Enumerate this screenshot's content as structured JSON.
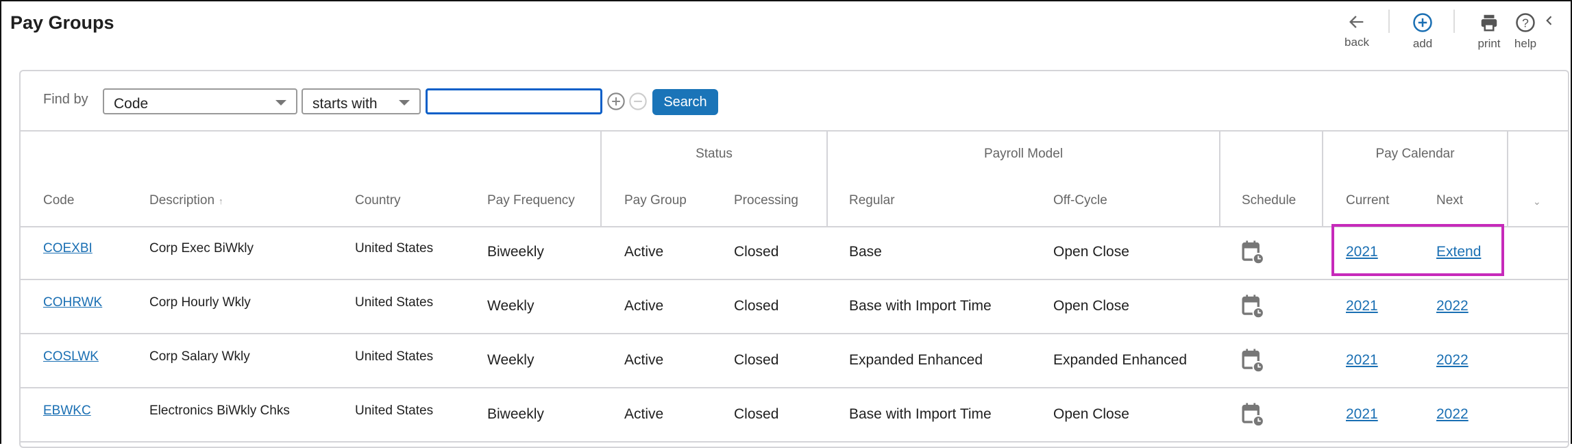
{
  "page": {
    "title": "Pay Groups"
  },
  "toolbar": {
    "back": {
      "label": "back",
      "icon": "arrow-left-icon"
    },
    "add": {
      "label": "add",
      "icon": "plus-circle-icon",
      "color": "#1a6fb3"
    },
    "print": {
      "label": "print",
      "icon": "printer-icon"
    },
    "help": {
      "label": "help",
      "icon": "question-circle-icon"
    },
    "collapse": {
      "icon": "chevron-left-icon"
    }
  },
  "find": {
    "label": "Find by",
    "field_value": "Code",
    "operator_value": "starts with",
    "search_value": "",
    "search_button": "Search"
  },
  "table": {
    "group_headers": {
      "status": "Status",
      "payroll_model": "Payroll Model",
      "pay_calendar": "Pay Calendar"
    },
    "columns": {
      "code": "Code",
      "description": "Description",
      "country": "Country",
      "pay_frequency": "Pay Frequency",
      "pay_group": "Pay Group",
      "processing": "Processing",
      "regular": "Regular",
      "off_cycle": "Off-Cycle",
      "schedule": "Schedule",
      "current": "Current",
      "next": "Next"
    },
    "sort": {
      "column": "Description",
      "direction": "ascending"
    },
    "rows": [
      {
        "code": "COEXBI",
        "description": "Corp Exec BiWkly",
        "country": "United States",
        "pay_frequency": "Biweekly",
        "pay_group": "Active",
        "processing": "Closed",
        "regular": "Base",
        "off_cycle": "Open Close",
        "current": "2021",
        "next": "Extend"
      },
      {
        "code": "COHRWK",
        "description": "Corp Hourly Wkly",
        "country": "United States",
        "pay_frequency": "Weekly",
        "pay_group": "Active",
        "processing": "Closed",
        "regular": "Base with Import Time",
        "off_cycle": "Open Close",
        "current": "2021",
        "next": "2022"
      },
      {
        "code": "COSLWK",
        "description": "Corp Salary Wkly",
        "country": "United States",
        "pay_frequency": "Weekly",
        "pay_group": "Active",
        "processing": "Closed",
        "regular": "Expanded Enhanced",
        "off_cycle": "Expanded Enhanced",
        "current": "2021",
        "next": "2022"
      },
      {
        "code": "EBWKC",
        "description": "Electronics BiWkly Chks",
        "country": "United States",
        "pay_frequency": "Biweekly",
        "pay_group": "Active",
        "processing": "Closed",
        "regular": "Base with Import Time",
        "off_cycle": "Open Close",
        "current": "2021",
        "next": "2022"
      }
    ]
  },
  "highlight": {
    "color": "#c62aba",
    "target": "row-1-pay-calendar"
  }
}
